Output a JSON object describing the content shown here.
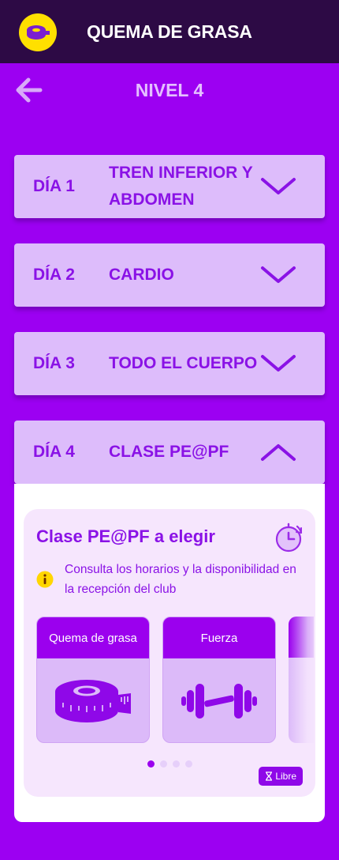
{
  "app": {
    "title": "QUEMA DE GRASA",
    "logo_icon": "measuring-tape-icon"
  },
  "nav": {
    "back_icon": "arrow-left-icon",
    "title": "NIVEL 4"
  },
  "days": [
    {
      "label": "DÍA 1",
      "name": "TREN INFERIOR Y ABDOMEN",
      "expanded": false
    },
    {
      "label": "DÍA 2",
      "name": "CARDIO",
      "expanded": false
    },
    {
      "label": "DÍA 3",
      "name": "TODO EL CUERPO",
      "expanded": false
    },
    {
      "label": "DÍA 4",
      "name": "CLASE PE@PF",
      "expanded": true
    }
  ],
  "class_card": {
    "title": "Clase PE@PF a elegir",
    "timer_icon": "stopwatch-icon",
    "info_icon": "info-icon",
    "info_text": "Consulta los horarios y la disponibilidad en la recepción del club",
    "options": [
      {
        "label": "Quema de grasa",
        "icon": "measuring-tape-icon"
      },
      {
        "label": "Fuerza",
        "icon": "dumbbell-icon"
      }
    ],
    "pagination": {
      "pages": 4,
      "active": 0
    },
    "badge": {
      "icon": "hourglass-icon",
      "label": "Libre"
    }
  },
  "colors": {
    "background": "#9c00f2",
    "topbar": "#2d0a45",
    "header_card": "#ddbcfb",
    "accent": "#8a12e6",
    "logo_bg": "#ffe000"
  }
}
